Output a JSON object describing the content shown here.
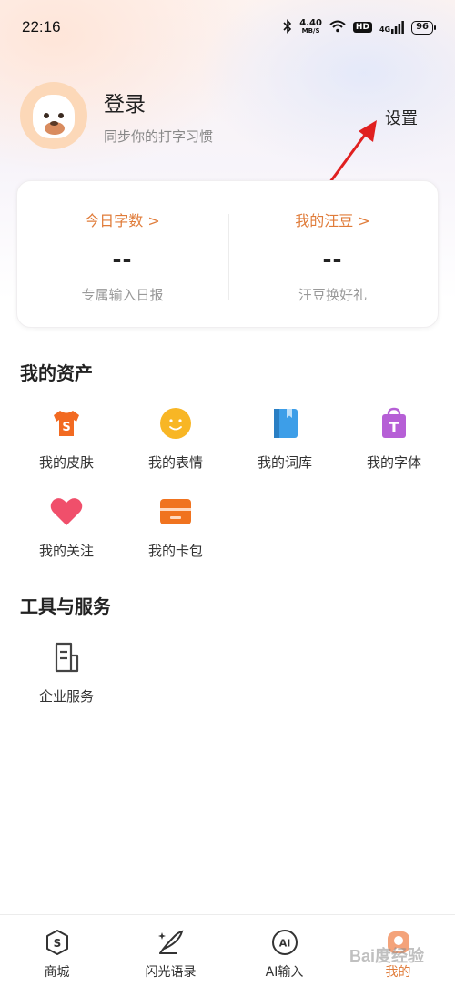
{
  "status_bar": {
    "time": "22:16",
    "net_speed_value": "4.40",
    "net_speed_unit": "MB/S",
    "hd": "HD",
    "signal": "4G",
    "battery": "96"
  },
  "profile": {
    "title": "登录",
    "subtitle": "同步你的打字习惯",
    "settings_label": "设置"
  },
  "stats": [
    {
      "label": "今日字数 >",
      "value": "--",
      "desc": "专属输入日报"
    },
    {
      "label": "我的汪豆 >",
      "value": "--",
      "desc": "汪豆换好礼"
    }
  ],
  "assets": {
    "title": "我的资产",
    "items": [
      {
        "label": "我的皮肤",
        "icon": "shirt-icon"
      },
      {
        "label": "我的表情",
        "icon": "smiley-icon"
      },
      {
        "label": "我的词库",
        "icon": "book-icon"
      },
      {
        "label": "我的字体",
        "icon": "font-bag-icon"
      },
      {
        "label": "我的关注",
        "icon": "heart-icon"
      },
      {
        "label": "我的卡包",
        "icon": "card-wallet-icon"
      }
    ]
  },
  "tools": {
    "title": "工具与服务",
    "items": [
      {
        "label": "企业服务",
        "icon": "document-icon"
      }
    ]
  },
  "tabbar": {
    "items": [
      {
        "label": "商城",
        "icon": "shop-icon"
      },
      {
        "label": "闪光语录",
        "icon": "quill-icon"
      },
      {
        "label": "AI输入",
        "icon": "ai-icon"
      },
      {
        "label": "我的",
        "icon": "profile-icon"
      }
    ],
    "active": "我的"
  },
  "watermark": "Bai度经验",
  "colors": {
    "accent": "#e07c3a",
    "shirt": "#f26a21",
    "smiley": "#f8b625",
    "book": "#3d9ee8",
    "font_bag": "#b65fd6",
    "heart": "#f04f6b",
    "card_wallet": "#f0731f",
    "arrow": "#e02020"
  }
}
